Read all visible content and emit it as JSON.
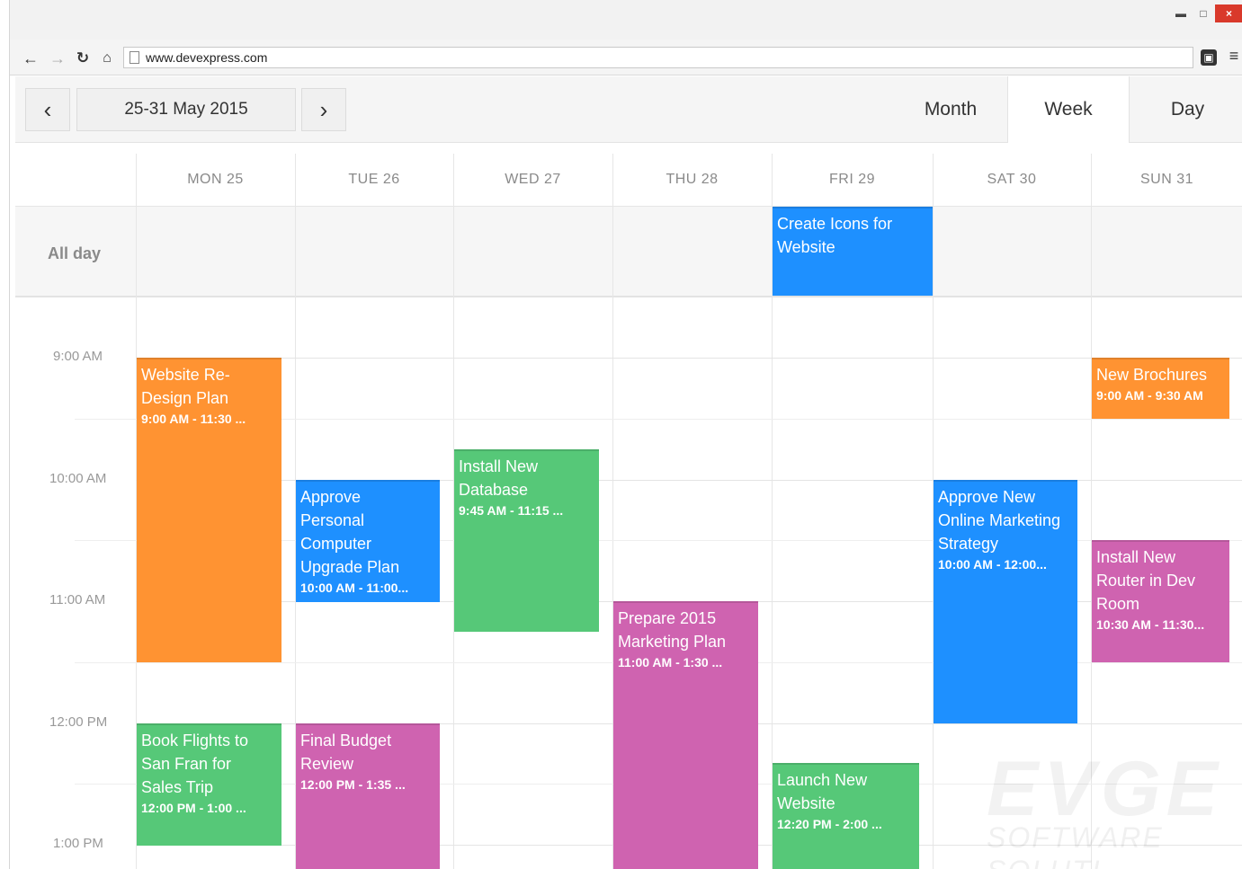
{
  "browser": {
    "url": "www.devexpress.com",
    "minimize_glyph": "▬",
    "maximize_glyph": "□",
    "close_glyph": "×",
    "extension_glyph": "▣",
    "menu_glyph": "≡"
  },
  "toolbar": {
    "prev_glyph": "‹",
    "next_glyph": "›",
    "date_range": "25-31 May 2015",
    "views": [
      "Month",
      "Week",
      "Day"
    ],
    "active_view": "Week"
  },
  "days": [
    "MON 25",
    "TUE 26",
    "WED 27",
    "THU 28",
    "FRI 29",
    "SAT 30",
    "SUN 31"
  ],
  "allday_label": "All day",
  "time_labels": [
    "9:00 AM",
    "10:00 AM",
    "11:00 AM",
    "12:00 PM",
    "1:00 PM"
  ],
  "allday_appointments": [
    {
      "day": 4,
      "title": "Create Icons for Website",
      "color": "#1e90ff"
    }
  ],
  "appointments": [
    {
      "day": 0,
      "start": 9.0,
      "end": 11.5,
      "title": "Website Re-Design Plan",
      "time": "9:00 AM - 11:30 ...",
      "color": "#ff9332"
    },
    {
      "day": 1,
      "start": 10.0,
      "end": 11.0,
      "title": "Approve Personal Computer Upgrade Plan",
      "time": "10:00 AM - 11:00...",
      "color": "#1e90ff"
    },
    {
      "day": 2,
      "start": 9.75,
      "end": 11.25,
      "title": "Install New Database",
      "time": "9:45 AM - 11:15 ...",
      "color": "#56c878"
    },
    {
      "day": 3,
      "start": 11.0,
      "end": 13.5,
      "title": "Prepare 2015 Marketing Plan",
      "time": "11:00 AM - 1:30 ...",
      "color": "#cf63b0"
    },
    {
      "day": 5,
      "start": 10.0,
      "end": 12.0,
      "title": "Approve New Online Marketing Strategy",
      "time": "10:00 AM - 12:00...",
      "color": "#1e90ff"
    },
    {
      "day": 6,
      "start": 9.0,
      "end": 9.5,
      "title": "New Brochures",
      "time": "9:00 AM - 9:30 AM",
      "color": "#ff9332"
    },
    {
      "day": 6,
      "start": 10.5,
      "end": 11.5,
      "title": "Install New Router in Dev Room",
      "time": "10:30 AM - 11:30...",
      "color": "#cf63b0"
    },
    {
      "day": 0,
      "start": 12.0,
      "end": 13.0,
      "title": "Book Flights to San Fran for Sales Trip",
      "time": "12:00 PM - 1:00 ...",
      "color": "#56c878"
    },
    {
      "day": 1,
      "start": 12.0,
      "end": 13.58,
      "title": "Final Budget Review",
      "time": "12:00 PM - 1:35 ...",
      "color": "#cf63b0"
    },
    {
      "day": 4,
      "start": 12.33,
      "end": 14.0,
      "title": "Launch New Website",
      "time": "12:20 PM - 2:00 ...",
      "color": "#56c878"
    }
  ],
  "watermark": {
    "line1": "EVGE",
    "line2": "SOFTWARE SOLUTI"
  }
}
